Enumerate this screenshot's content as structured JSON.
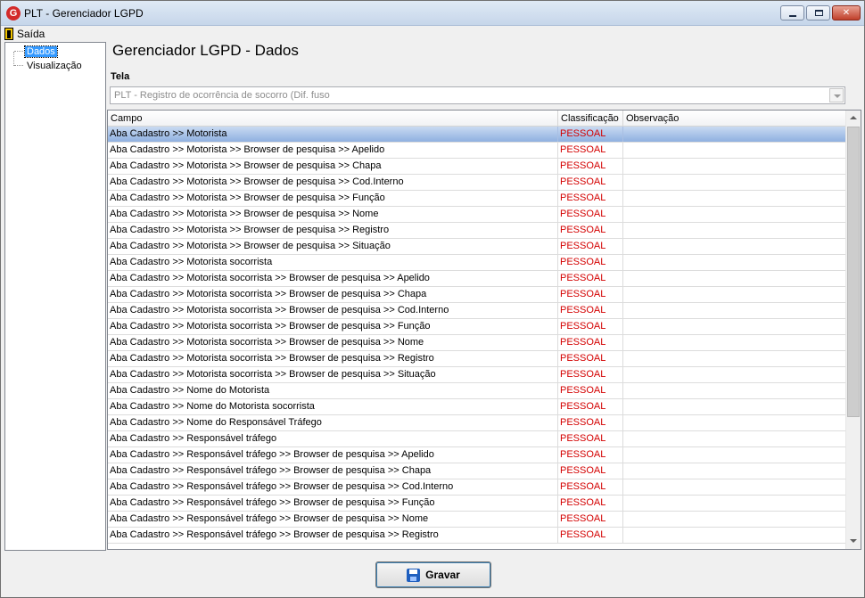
{
  "window": {
    "title": "PLT - Gerenciador LGPD"
  },
  "menu": {
    "exit_label": "Saída"
  },
  "tree": {
    "items": [
      {
        "label": "Dados",
        "selected": true
      },
      {
        "label": "Visualização",
        "selected": false
      }
    ]
  },
  "main": {
    "title": "Gerenciador LGPD - Dados",
    "tela_label": "Tela",
    "tela_value": "PLT - Registro de ocorrência de socorro (Dif. fuso"
  },
  "grid": {
    "columns": [
      "Campo",
      "Classificação",
      "Observação"
    ],
    "rows": [
      {
        "campo": "Aba Cadastro >> Motorista",
        "classificacao": "PESSOAL",
        "observacao": ""
      },
      {
        "campo": "Aba Cadastro >> Motorista >> Browser de pesquisa >> Apelido",
        "classificacao": "PESSOAL",
        "observacao": ""
      },
      {
        "campo": "Aba Cadastro >> Motorista >> Browser de pesquisa >> Chapa",
        "classificacao": "PESSOAL",
        "observacao": ""
      },
      {
        "campo": "Aba Cadastro >> Motorista >> Browser de pesquisa >> Cod.Interno",
        "classificacao": "PESSOAL",
        "observacao": ""
      },
      {
        "campo": "Aba Cadastro >> Motorista >> Browser de pesquisa >> Função",
        "classificacao": "PESSOAL",
        "observacao": ""
      },
      {
        "campo": "Aba Cadastro >> Motorista >> Browser de pesquisa >> Nome",
        "classificacao": "PESSOAL",
        "observacao": ""
      },
      {
        "campo": "Aba Cadastro >> Motorista >> Browser de pesquisa >> Registro",
        "classificacao": "PESSOAL",
        "observacao": ""
      },
      {
        "campo": "Aba Cadastro >> Motorista >> Browser de pesquisa >> Situação",
        "classificacao": "PESSOAL",
        "observacao": ""
      },
      {
        "campo": "Aba Cadastro >> Motorista socorrista",
        "classificacao": "PESSOAL",
        "observacao": ""
      },
      {
        "campo": "Aba Cadastro >> Motorista socorrista >> Browser de pesquisa >> Apelido",
        "classificacao": "PESSOAL",
        "observacao": ""
      },
      {
        "campo": "Aba Cadastro >> Motorista socorrista >> Browser de pesquisa >> Chapa",
        "classificacao": "PESSOAL",
        "observacao": ""
      },
      {
        "campo": "Aba Cadastro >> Motorista socorrista >> Browser de pesquisa >> Cod.Interno",
        "classificacao": "PESSOAL",
        "observacao": ""
      },
      {
        "campo": "Aba Cadastro >> Motorista socorrista >> Browser de pesquisa >> Função",
        "classificacao": "PESSOAL",
        "observacao": ""
      },
      {
        "campo": "Aba Cadastro >> Motorista socorrista >> Browser de pesquisa >> Nome",
        "classificacao": "PESSOAL",
        "observacao": ""
      },
      {
        "campo": "Aba Cadastro >> Motorista socorrista >> Browser de pesquisa >> Registro",
        "classificacao": "PESSOAL",
        "observacao": ""
      },
      {
        "campo": "Aba Cadastro >> Motorista socorrista >> Browser de pesquisa >> Situação",
        "classificacao": "PESSOAL",
        "observacao": ""
      },
      {
        "campo": "Aba Cadastro >> Nome do Motorista",
        "classificacao": "PESSOAL",
        "observacao": ""
      },
      {
        "campo": "Aba Cadastro >> Nome do Motorista socorrista",
        "classificacao": "PESSOAL",
        "observacao": ""
      },
      {
        "campo": "Aba Cadastro >> Nome do Responsável Tráfego",
        "classificacao": "PESSOAL",
        "observacao": ""
      },
      {
        "campo": "Aba Cadastro >> Responsável tráfego",
        "classificacao": "PESSOAL",
        "observacao": ""
      },
      {
        "campo": "Aba Cadastro >> Responsável tráfego >> Browser de pesquisa >> Apelido",
        "classificacao": "PESSOAL",
        "observacao": ""
      },
      {
        "campo": "Aba Cadastro >> Responsável tráfego >> Browser de pesquisa >> Chapa",
        "classificacao": "PESSOAL",
        "observacao": ""
      },
      {
        "campo": "Aba Cadastro >> Responsável tráfego >> Browser de pesquisa >> Cod.Interno",
        "classificacao": "PESSOAL",
        "observacao": ""
      },
      {
        "campo": "Aba Cadastro >> Responsável tráfego >> Browser de pesquisa >> Função",
        "classificacao": "PESSOAL",
        "observacao": ""
      },
      {
        "campo": "Aba Cadastro >> Responsável tráfego >> Browser de pesquisa >> Nome",
        "classificacao": "PESSOAL",
        "observacao": ""
      },
      {
        "campo": "Aba Cadastro >> Responsável tráfego >> Browser de pesquisa >> Registro",
        "classificacao": "PESSOAL",
        "observacao": ""
      }
    ]
  },
  "footer": {
    "save_label": "Gravar"
  },
  "colors": {
    "classification_text": "#d40000",
    "selection": "#3399ff"
  }
}
